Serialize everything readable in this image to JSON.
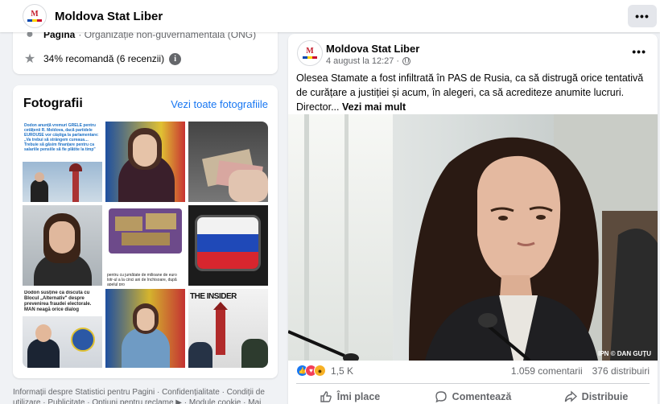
{
  "header": {
    "page_name": "Moldova Stat Liber",
    "more_label": "•••"
  },
  "intro": {
    "category_label": "Pagină",
    "category_value": " · Organizație non-guvernamentală (ONG)",
    "recommend_text": "34% recomandă (6 recenzii)",
    "info_label": "i"
  },
  "photos": {
    "heading": "Fotografii",
    "see_all": "Vezi toate fotografiile",
    "tile1_text": "Dodon anunță vremuri GRELE pentru cetățenii R. Moldova, dacă partidele EUROUSE vor câștiga la parlamentare: „Va trebui să strângem cureaua… Trebuie să găsim finanțare pentru ca salariile pensiile să fie plătite la timp\"",
    "tile5_text": "pentru cu jumătate de milioane de euro lotr-ul a la cinci ani de închisoare, după apelul pro",
    "tile7_text": "Dodon susține că discută cu Blocul „Alternativ\" despre prevenirea fraudei electorale. MAN neagă orice dialog",
    "tile8_text": "",
    "tile9_text": "THE INSIDER"
  },
  "footer": {
    "text": "Informații despre Statistici pentru Pagini · Confidențialitate · Condiții de utilizare · Publicitate · Opțiuni pentru reclame ▶ · Module cookie · Mai"
  },
  "post": {
    "author": "Moldova Stat Liber",
    "timestamp": "4 august la 12:27",
    "more": "•••",
    "text": "Olesea Stamate a fost infiltrată în PAS de Rusia, ca să distrugă orice tentativă de curățare a justiției și acum, în alegeri, ca să acrediteze anumite lucruri. Director... ",
    "see_more": "Vezi mai mult",
    "photo_credit": "IPN © DAN GUȚU",
    "reactions_count": "1,5 K",
    "comments": "1.059 comentarii",
    "shares": "376 distribuiri",
    "actions": {
      "like": "Îmi place",
      "comment": "Comentează",
      "share": "Distribuie"
    }
  },
  "colors": {
    "accent": "#1877f2",
    "background": "#f0f2f5",
    "card": "#ffffff",
    "secondary_text": "#65676b"
  },
  "icons": [
    "page-avatar-logo",
    "more-icon",
    "star-icon",
    "info-icon",
    "globe-icon",
    "like-reaction-icon",
    "love-reaction-icon",
    "wow-reaction-icon",
    "thumbs-up-icon",
    "comment-icon",
    "share-icon"
  ]
}
